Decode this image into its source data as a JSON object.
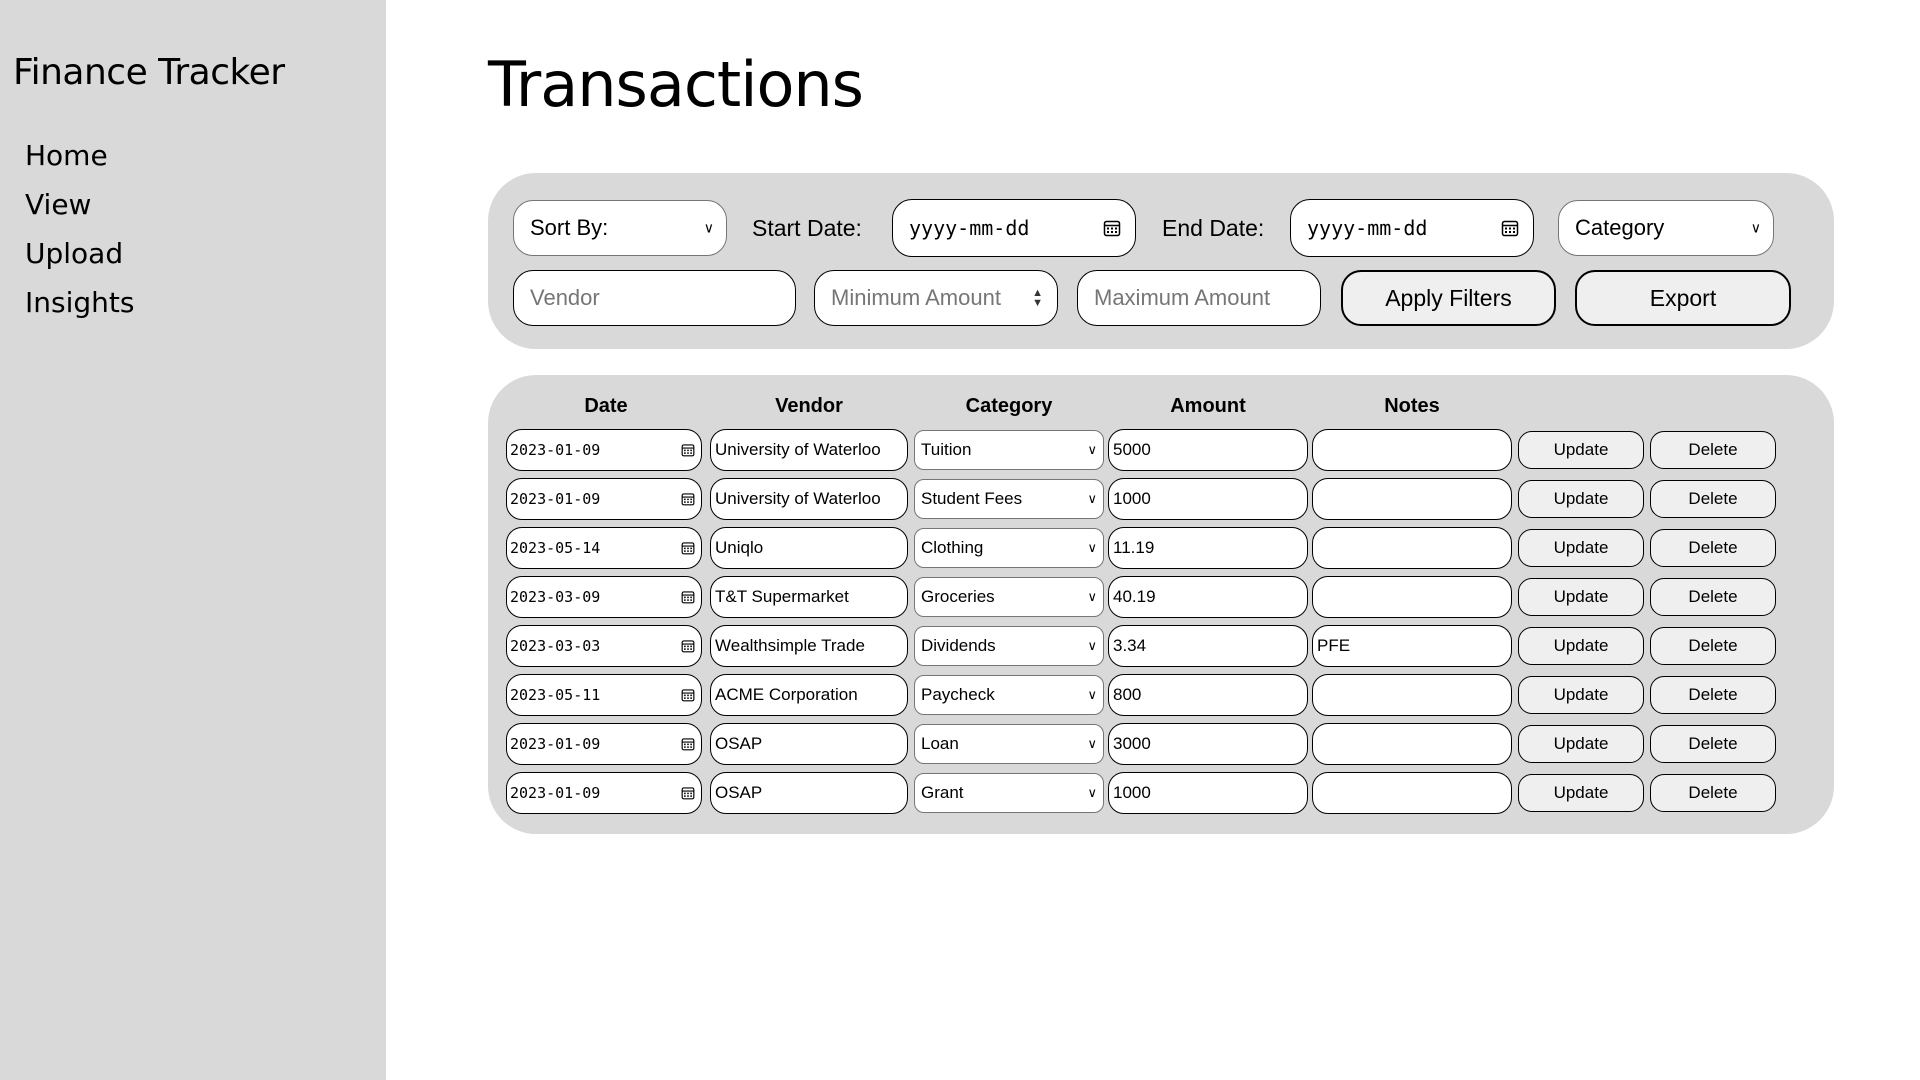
{
  "sidebar": {
    "app_title": "Finance Tracker",
    "nav": [
      "Home",
      "View",
      "Upload",
      "Insights"
    ]
  },
  "page": {
    "title": "Transactions"
  },
  "filters": {
    "sort_by": "Sort By:",
    "start_date_label": "Start Date:",
    "start_date_placeholder": "yyyy-mm-dd",
    "end_date_label": "End Date:",
    "end_date_placeholder": "yyyy-mm-dd",
    "category": "Category",
    "vendor_placeholder": "Vendor",
    "min_amount_placeholder": "Minimum Amount",
    "max_amount_placeholder": "Maximum Amount",
    "apply_label": "Apply Filters",
    "export_label": "Export"
  },
  "table": {
    "columns": [
      "Date",
      "Vendor",
      "Category",
      "Amount",
      "Notes"
    ],
    "update_label": "Update",
    "delete_label": "Delete",
    "rows": [
      {
        "date": "2023-01-09",
        "vendor": "University of Waterloo",
        "category": "Tuition",
        "amount": "5000",
        "notes": ""
      },
      {
        "date": "2023-01-09",
        "vendor": "University of Waterloo",
        "category": "Student Fees",
        "amount": "1000",
        "notes": ""
      },
      {
        "date": "2023-05-14",
        "vendor": "Uniqlo",
        "category": "Clothing",
        "amount": "11.19",
        "notes": ""
      },
      {
        "date": "2023-03-09",
        "vendor": "T&T Supermarket",
        "category": "Groceries",
        "amount": "40.19",
        "notes": ""
      },
      {
        "date": "2023-03-03",
        "vendor": "Wealthsimple Trade",
        "category": "Dividends",
        "amount": "3.34",
        "notes": "PFE"
      },
      {
        "date": "2023-05-11",
        "vendor": "ACME Corporation",
        "category": "Paycheck",
        "amount": "800",
        "notes": ""
      },
      {
        "date": "2023-01-09",
        "vendor": "OSAP",
        "category": "Loan",
        "amount": "3000",
        "notes": ""
      },
      {
        "date": "2023-01-09",
        "vendor": "OSAP",
        "category": "Grant",
        "amount": "1000",
        "notes": ""
      }
    ]
  },
  "icons": {
    "calendar": "calendar-icon",
    "chevron": "chevron-down-icon",
    "spinner": "spinner-arrows-icon"
  },
  "colors": {
    "sidebar_bg": "#d9d9d9",
    "panel_bg": "#d9d9d9",
    "button_bg": "#efefef"
  }
}
